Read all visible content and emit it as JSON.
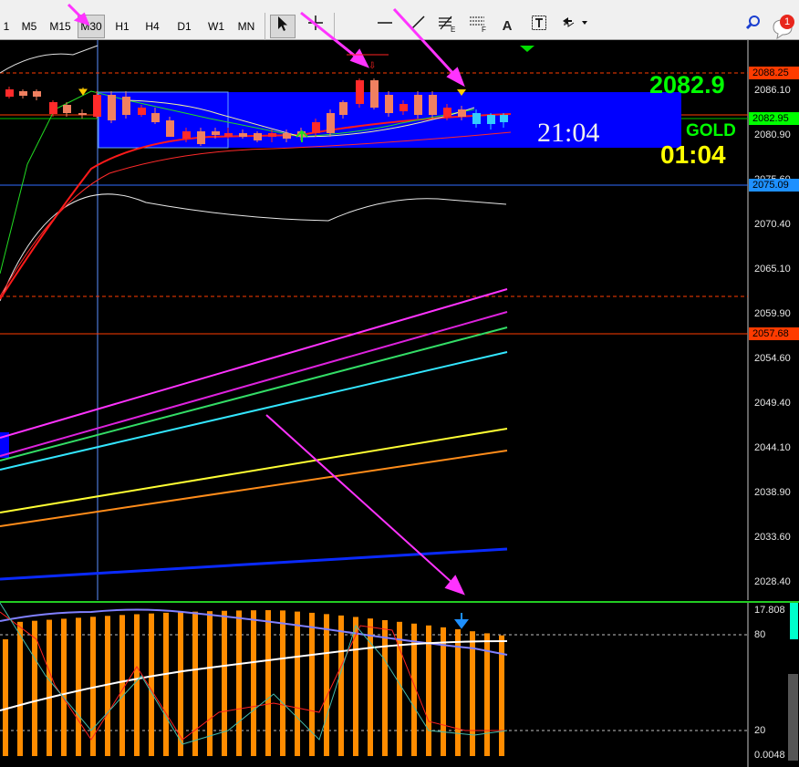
{
  "toolbar": {
    "timeframes": [
      "1",
      "M5",
      "M15",
      "M30",
      "H1",
      "H4",
      "D1",
      "W1",
      "MN"
    ],
    "active_timeframe": "M30",
    "tools": [
      "cursor-icon",
      "crosshair-icon",
      "horizontal-line-icon",
      "trendline-icon",
      "fibonacci-icon",
      "fibo-fan-icon",
      "text-icon",
      "text-label-icon",
      "arrows-icon"
    ],
    "search_icon": "search-icon",
    "notification_count": "1"
  },
  "price_scale": {
    "labels": [
      "2086.10",
      "2080.90",
      "2075.60",
      "2070.40",
      "2065.10",
      "2059.90",
      "2054.60",
      "2049.40",
      "2044.10",
      "2038.90",
      "2033.60",
      "2028.40"
    ],
    "price_tags": [
      {
        "value": "2088.25",
        "bg": "#ff3b00",
        "fg": "#000000"
      },
      {
        "value": "2082.95",
        "bg": "#00ff00",
        "fg": "#000000"
      },
      {
        "value": "2075.09",
        "bg": "#1e90ff",
        "fg": "#000000"
      },
      {
        "value": "2057.68",
        "bg": "#ff3b00",
        "fg": "#000000"
      }
    ]
  },
  "overlay": {
    "price_big": "2082.9",
    "timer": "21:04",
    "symbol": "GOLD",
    "countdown": "01:04"
  },
  "oscillator": {
    "labels": [
      "17.808",
      "80",
      "20",
      "0.0048"
    ]
  },
  "colors": {
    "background": "#000000",
    "price_green": "#00ff00",
    "countdown_yellow": "#ffff00",
    "box_blue": "#0000ff",
    "histogram": "#ff8c00",
    "annotation_arrow": "#ff33ff"
  }
}
